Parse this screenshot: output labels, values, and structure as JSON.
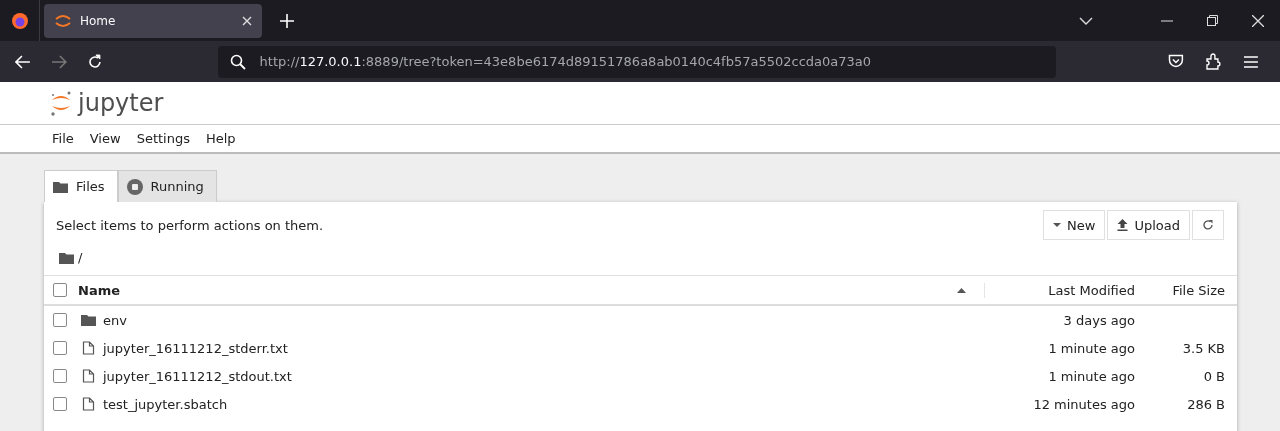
{
  "browser": {
    "tab": {
      "title": "Home",
      "selected": true
    },
    "url": {
      "scheme": "http://",
      "host": "127.0.0.1",
      "rest": ":8889/tree?token=43e8be6174d89151786a8ab0140c4fb57a5502ccda0a73a0"
    }
  },
  "app": {
    "logo": "jupyter",
    "menu": [
      "File",
      "View",
      "Settings",
      "Help"
    ]
  },
  "tabs": [
    {
      "label": "Files",
      "selected": true,
      "kind": "folder"
    },
    {
      "label": "Running",
      "selected": false,
      "kind": "stop"
    }
  ],
  "toolbar": {
    "hint": "Select items to perform actions on them.",
    "buttons": [
      {
        "label": "New",
        "kind": "caret"
      },
      {
        "label": "Upload",
        "kind": "upload"
      },
      {
        "kind": "refresh"
      }
    ]
  },
  "breadcrumb": "/",
  "table": {
    "select_all": {
      "checked": false
    },
    "columns": [
      "Name",
      "Last Modified",
      "File Size"
    ],
    "rows": [
      {
        "name": "env",
        "kind": "folder",
        "modified": "3 days ago",
        "checked": false
      },
      {
        "name": "jupyter_16111212_stderr.txt",
        "kind": "file",
        "modified": "1 minute ago",
        "size": "3.5 KB",
        "checked": false
      },
      {
        "name": "jupyter_16111212_stdout.txt",
        "kind": "file",
        "modified": "1 minute ago",
        "size": "0 B",
        "checked": false
      },
      {
        "name": "test_jupyter.sbatch",
        "kind": "file",
        "modified": "12 minutes ago",
        "size": "286 B",
        "checked": false
      }
    ]
  }
}
